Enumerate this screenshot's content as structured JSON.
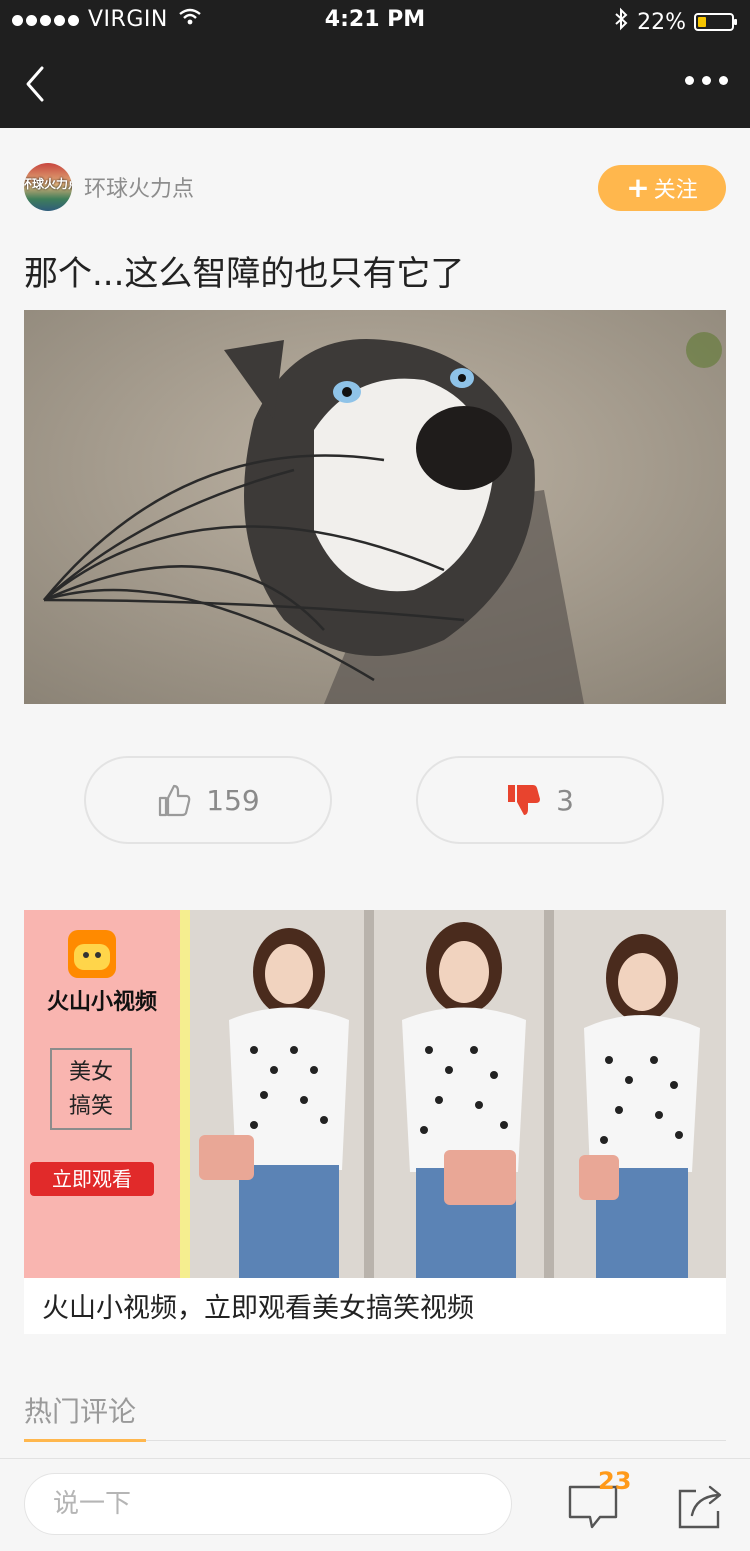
{
  "status_bar": {
    "carrier": "VIRGIN",
    "time": "4:21 PM",
    "battery": "22%",
    "battery_level": 0.22
  },
  "article": {
    "author_name": "环球火力点",
    "author_avatar_text": "环球火力点",
    "follow_label": "关注",
    "title": "那个...这么智障的也只有它了"
  },
  "votes": {
    "like_count": "159",
    "dislike_count": "3"
  },
  "ad": {
    "app_name": "火山小视频",
    "tag_line1": "美女",
    "tag_line2": "搞笑",
    "watch_label": "立即观看",
    "caption": "火山小视频，立即观看美女搞笑视频"
  },
  "comments": {
    "section_title": "热门评论"
  },
  "bottom_bar": {
    "input_placeholder": "说一下",
    "comment_count": "23"
  },
  "colors": {
    "nav_bg": "#1f1f1f",
    "accent": "#ffb74d",
    "dislike_red": "#e8442e",
    "badge_orange": "#ff9a1a"
  },
  "icons": [
    "back-arrow-icon",
    "more-icon",
    "plus-icon",
    "thumbs-up-icon",
    "thumbs-down-icon",
    "comment-icon",
    "share-icon",
    "wifi-icon",
    "bluetooth-icon",
    "battery-icon"
  ]
}
